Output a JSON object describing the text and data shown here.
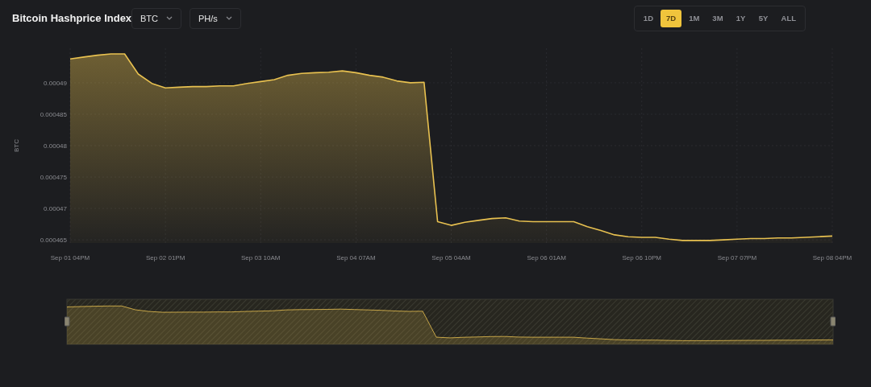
{
  "header": {
    "title": "Bitcoin Hashprice Index",
    "dropdowns": [
      {
        "label": "BTC"
      },
      {
        "label": "PH/s"
      }
    ]
  },
  "ranges": [
    {
      "label": "1D",
      "selected": false
    },
    {
      "label": "7D",
      "selected": true
    },
    {
      "label": "1M",
      "selected": false
    },
    {
      "label": "3M",
      "selected": false
    },
    {
      "label": "1Y",
      "selected": false
    },
    {
      "label": "5Y",
      "selected": false
    },
    {
      "label": "ALL",
      "selected": false
    }
  ],
  "chart": {
    "chart_data": {
      "type": "area",
      "grid": true,
      "ylabel": "BTC",
      "ylim": [
        0.0004645,
        0.0004955
      ],
      "yticks": [
        {
          "value": 0.000465,
          "label": "0.000465"
        },
        {
          "value": 0.00047,
          "label": "0.00047"
        },
        {
          "value": 0.000475,
          "label": "0.000475"
        },
        {
          "value": 0.00048,
          "label": "0.00048"
        },
        {
          "value": 0.000485,
          "label": "0.000485"
        },
        {
          "value": 0.00049,
          "label": "0.00049"
        }
      ],
      "categories": [
        "Sep 01 04PM",
        null,
        null,
        null,
        null,
        null,
        null,
        "Sep 02 01PM",
        null,
        null,
        null,
        null,
        null,
        null,
        "Sep 03 10AM",
        null,
        null,
        null,
        null,
        null,
        null,
        "Sep 04 07AM",
        null,
        null,
        null,
        null,
        null,
        null,
        "Sep 05 04AM",
        null,
        null,
        null,
        null,
        null,
        null,
        "Sep 06 01AM",
        null,
        null,
        null,
        null,
        null,
        null,
        "Sep 06 10PM",
        null,
        null,
        null,
        null,
        null,
        null,
        "Sep 07 07PM",
        null,
        null,
        null,
        null,
        null,
        null,
        "Sep 08 04PM"
      ],
      "series": [
        {
          "color": "#e8c150",
          "values": [
            0.0004938,
            0.0004941,
            0.0004944,
            0.0004946,
            0.0004946,
            0.0004914,
            0.0004899,
            0.0004892,
            0.0004893,
            0.0004894,
            0.0004894,
            0.0004895,
            0.0004895,
            0.0004899,
            0.0004902,
            0.0004905,
            0.0004912,
            0.0004915,
            0.0004916,
            0.0004917,
            0.0004919,
            0.0004916,
            0.0004912,
            0.0004909,
            0.0004903,
            0.00049,
            0.0004901,
            0.0004679,
            0.0004673,
            0.0004678,
            0.0004681,
            0.0004684,
            0.0004685,
            0.000468,
            0.0004679,
            0.0004679,
            0.0004679,
            0.0004679,
            0.0004671,
            0.0004665,
            0.0004658,
            0.0004655,
            0.0004654,
            0.0004654,
            0.0004651,
            0.0004649,
            0.0004649,
            0.0004649,
            0.000465,
            0.0004651,
            0.0004652,
            0.0004652,
            0.0004653,
            0.0004653,
            0.0004654,
            0.0004655,
            0.0004656
          ]
        }
      ]
    }
  }
}
